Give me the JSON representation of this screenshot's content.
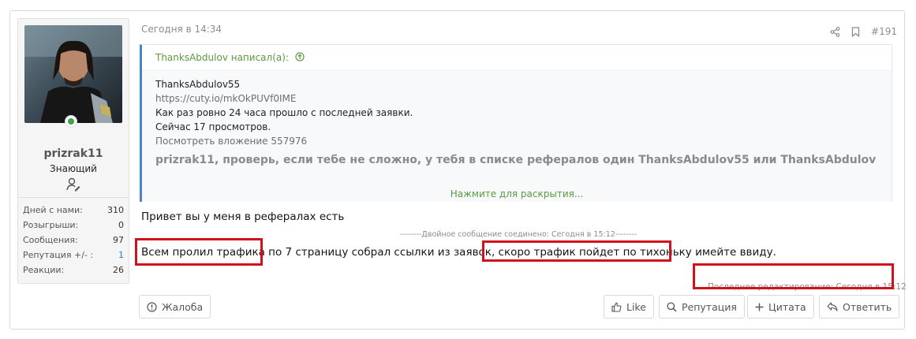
{
  "user": {
    "name": "prizrak11",
    "title": "Знающий",
    "stats": [
      {
        "label": "Дней с нами:",
        "value": "310",
        "color": "#333333"
      },
      {
        "label": "Розыгрыши:",
        "value": "0",
        "color": "#333333"
      },
      {
        "label": "Сообщения:",
        "value": "97",
        "color": "#333333"
      },
      {
        "label": "Репутация +/- :",
        "value": "1",
        "color": "#2b77c5"
      },
      {
        "label": "Реакции:",
        "value": "26",
        "color": "#333333"
      }
    ]
  },
  "post": {
    "date": "Сегодня в 14:34",
    "number": "#191",
    "quote": {
      "header": "ThanksAbdulov написал(а):",
      "lines": [
        "ThanksAbdulov55",
        "https://cuty.io/mkOkPUVf0IME",
        "Как раз ровно 24 часа прошло с последней заявки.",
        "Сейчас 17 просмотров.",
        "Посмотреть вложение 557976"
      ],
      "bold_line": "prizrak11, проверь, если тебе не сложно, у тебя в списке рефералов один ThanksAbdulov55 или ThanksAbdulov",
      "expand": "Нажмите для раскрытия..."
    },
    "message1": "Привет вы у меня в рефералах есть",
    "merge_notice": "--------Двойное сообщение соединено: Сегодня в 15:12--------",
    "message2": "Всем пролил трафика по 7 страницу собрал ссылки из заявок, скоро трафик пойдет по тихоньку имейте ввиду.",
    "last_edit": "Последнее редактирование: Сегодня в 15:12"
  },
  "buttons": {
    "report": "Жалоба",
    "like": "Like",
    "reputation": "Репутация",
    "quote": "Цитата",
    "reply": "Ответить"
  },
  "colors": {
    "highlight": "#d0121d",
    "quote_border": "#4a86c7",
    "quote_link": "#5a9b3e",
    "online": "#3fa34d"
  }
}
